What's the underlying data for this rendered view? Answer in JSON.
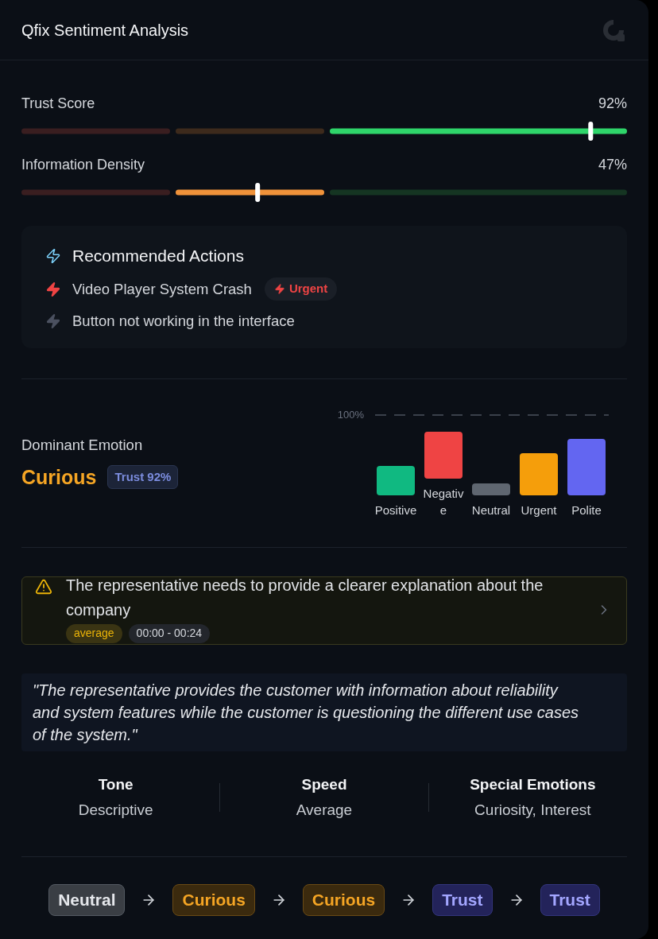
{
  "header": {
    "title": "Qfix Sentiment Analysis"
  },
  "gauges": [
    {
      "label": "Trust Score",
      "reading": "92%",
      "level": 0.94
    },
    {
      "label": "Information Density",
      "reading": "47%",
      "level": 0.39
    }
  ],
  "recommended_actions": {
    "title": "Recommended Actions",
    "items": [
      {
        "text": "Video Player System Crash",
        "urgent": true,
        "badge": "Urgent"
      },
      {
        "text": "Button not working in the interface",
        "urgent": false
      }
    ]
  },
  "dominant_emotion": {
    "label": "Dominant Emotion",
    "emotion": "Curious",
    "badge": "Trust 92%"
  },
  "emotion_chart": {
    "scale_label": "100%",
    "bars": [
      {
        "label": "Positive",
        "color": "#10b981"
      },
      {
        "label": "Negative",
        "color": "#ef4444"
      },
      {
        "label": "Neutral",
        "color": "#5f6670"
      },
      {
        "label": "Urgent",
        "color": "#f59e0b"
      },
      {
        "label": "Polite",
        "color": "#6366f1"
      }
    ]
  },
  "insight": {
    "text": "The representative needs to provide a clearer explanation about the company",
    "tag": "average",
    "time": "00:00 - 00:24"
  },
  "summary_quote": "\"The representative provides the customer with information about reliability and system features while the customer is questioning the different use cases of the system.\"",
  "stats": [
    {
      "label": "Tone",
      "value": "Descriptive"
    },
    {
      "label": "Speed",
      "value": "Average"
    },
    {
      "label": "Special Emotions",
      "value": "Curiosity, Interest"
    }
  ],
  "emotion_flow": [
    {
      "label": "Neutral",
      "kind": "neutral"
    },
    {
      "label": "Curious",
      "kind": "curious"
    },
    {
      "label": "Curious",
      "kind": "curious"
    },
    {
      "label": "Trust",
      "kind": "trust"
    },
    {
      "label": "Trust",
      "kind": "trust"
    }
  ]
}
